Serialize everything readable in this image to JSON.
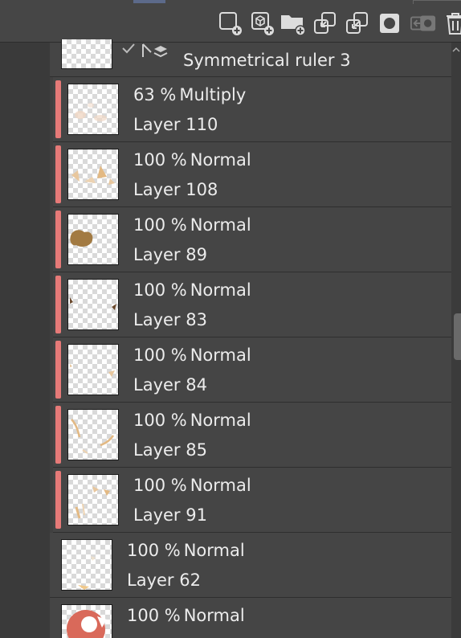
{
  "toolbar": {
    "buttons": [
      {
        "name": "new-raster-layer-icon"
      },
      {
        "name": "new-vector-layer-icon"
      },
      {
        "name": "new-layer-folder-icon"
      },
      {
        "name": "transfer-to-lower-layer-icon"
      },
      {
        "name": "combine-with-layer-below-icon"
      },
      {
        "name": "create-layer-mask-icon"
      },
      {
        "name": "apply-mask-icon"
      },
      {
        "name": "delete-layer-icon"
      }
    ]
  },
  "ruler_layer": {
    "name": "Symmetrical ruler 3"
  },
  "layers": [
    {
      "opacity": "63 %",
      "mode": "Multiply",
      "name": "Layer 110",
      "clipped": true
    },
    {
      "opacity": "100 %",
      "mode": "Normal",
      "name": "Layer 108",
      "clipped": true
    },
    {
      "opacity": "100 %",
      "mode": "Normal",
      "name": "Layer 89",
      "clipped": true
    },
    {
      "opacity": "100 %",
      "mode": "Normal",
      "name": "Layer 83",
      "clipped": true
    },
    {
      "opacity": "100 %",
      "mode": "Normal",
      "name": "Layer 84",
      "clipped": true
    },
    {
      "opacity": "100 %",
      "mode": "Normal",
      "name": "Layer 85",
      "clipped": true
    },
    {
      "opacity": "100 %",
      "mode": "Normal",
      "name": "Layer 91",
      "clipped": true
    },
    {
      "opacity": "100 %",
      "mode": "Normal",
      "name": "Layer 62",
      "clipped": false
    },
    {
      "opacity": "100 %",
      "mode": "Normal",
      "name": "",
      "clipped": false
    }
  ],
  "colors": {
    "clip_indicator": "#e67a78",
    "panel_bg": "#404040",
    "row_bg": "#454545"
  }
}
